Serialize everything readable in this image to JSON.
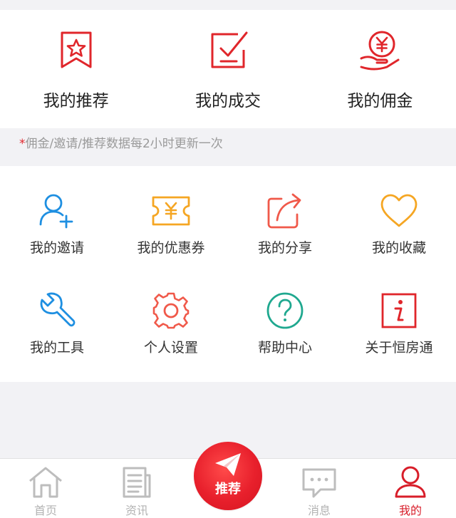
{
  "top_actions": [
    {
      "label": "我的推荐",
      "icon": "bookmark-star-icon"
    },
    {
      "label": "我的成交",
      "icon": "check-square-icon"
    },
    {
      "label": "我的佣金",
      "icon": "yuan-hand-icon"
    }
  ],
  "note": {
    "star": "*",
    "text": "佣金/邀请/推荐数据每2小时更新一次"
  },
  "grid": [
    {
      "label": "我的邀请",
      "icon": "user-plus-icon"
    },
    {
      "label": "我的优惠券",
      "icon": "coupon-icon"
    },
    {
      "label": "我的分享",
      "icon": "share-icon"
    },
    {
      "label": "我的收藏",
      "icon": "heart-icon"
    },
    {
      "label": "我的工具",
      "icon": "wrench-icon"
    },
    {
      "label": "个人设置",
      "icon": "gear-icon"
    },
    {
      "label": "帮助中心",
      "icon": "question-icon"
    },
    {
      "label": "关于恒房通",
      "icon": "info-icon"
    }
  ],
  "tabbar": {
    "home": "首页",
    "news": "资讯",
    "recommend": "推荐",
    "messages": "消息",
    "mine": "我的"
  },
  "colors": {
    "primary_red": "#e0262b",
    "blue": "#1e8fe1",
    "orange": "#f5a623",
    "coral": "#f0594a",
    "teal": "#1fa88f",
    "inactive": "#b3b3b3"
  }
}
